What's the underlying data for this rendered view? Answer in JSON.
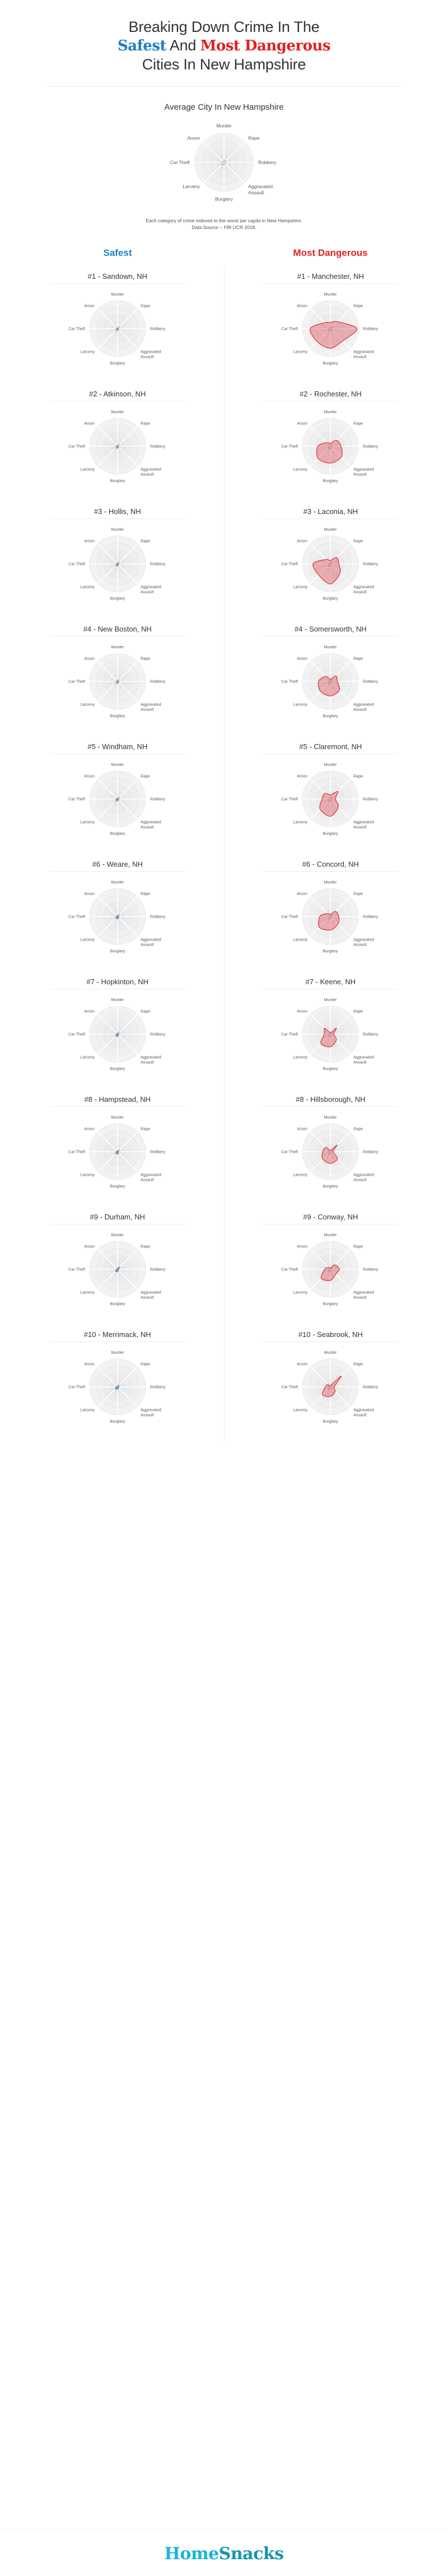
{
  "title": {
    "line1": "Breaking Down Crime In The",
    "line2_a": "Safest",
    "line2_b": "And",
    "line2_c": "Most Dangerous",
    "line3": "Cities In New Hampshire"
  },
  "reference": {
    "heading": "Average City In New Hampshire",
    "source_line1": "Each category of crime indexed to the worst per capita in New Hampshire.",
    "source_line2": "Data Source -- FBI UCR 2018."
  },
  "axes": [
    "Murder",
    "Rape",
    "Robbery",
    "Aggravated Assault",
    "Burglary",
    "Larceny",
    "Car Theft",
    "Arson"
  ],
  "columns": {
    "safest_label": "Safest",
    "dangerous_label": "Most Dangerous"
  },
  "colors": {
    "safe": "#2e86c8",
    "safe_fill": "rgba(46,134,200,0.45)",
    "danger": "#d6323c",
    "danger_fill": "rgba(214,50,60,0.35)",
    "average_fill": "rgba(150,150,150,0.30)",
    "grid": "#ededed",
    "title_blue": "#1d7fc4",
    "title_red": "#e02020",
    "logo_light": "#18b6d8",
    "logo_dark": "#1596ad"
  },
  "footer": {
    "logo_part1": "Home",
    "logo_part2": "Snacks"
  },
  "chart_data": {
    "type": "radar",
    "title": "Breaking Down Crime In The Safest And Most Dangerous Cities In New Hampshire",
    "subtitle": "Each category of crime indexed to the worst per capita in New Hampshire. Data Source -- FBI UCR 2018.",
    "categories": [
      "Murder",
      "Rape",
      "Robbery",
      "Aggravated Assault",
      "Burglary",
      "Larceny",
      "Car Theft",
      "Arson"
    ],
    "rlim": [
      0,
      1
    ],
    "grid": true,
    "legend": "none",
    "reference_series": {
      "name": "Average City In New Hampshire",
      "values": [
        0.06,
        0.1,
        0.05,
        0.07,
        0.09,
        0.12,
        0.07,
        0.05
      ]
    },
    "safest": [
      {
        "rank": "#1",
        "city": "Sandown, NH",
        "label": "#1 - Sandown, NH",
        "values": [
          0.0,
          0.02,
          0.0,
          0.02,
          0.05,
          0.04,
          0.01,
          0.0
        ]
      },
      {
        "rank": "#2",
        "city": "Atkinson, NH",
        "label": "#2 - Atkinson, NH",
        "values": [
          0.0,
          0.02,
          0.0,
          0.02,
          0.05,
          0.05,
          0.02,
          0.0
        ]
      },
      {
        "rank": "#3",
        "city": "Hollis, NH",
        "label": "#3 - Hollis, NH",
        "values": [
          0.0,
          0.03,
          0.0,
          0.01,
          0.06,
          0.05,
          0.02,
          0.0
        ]
      },
      {
        "rank": "#4",
        "city": "New Boston, NH",
        "label": "#4 - New Boston, NH",
        "values": [
          0.0,
          0.03,
          0.0,
          0.03,
          0.05,
          0.04,
          0.02,
          0.01
        ]
      },
      {
        "rank": "#5",
        "city": "Windham, NH",
        "label": "#5 - Windham, NH",
        "values": [
          0.0,
          0.04,
          0.01,
          0.03,
          0.05,
          0.06,
          0.03,
          0.0
        ]
      },
      {
        "rank": "#6",
        "city": "Weare, NH",
        "label": "#6 - Weare, NH",
        "values": [
          0.0,
          0.05,
          0.0,
          0.05,
          0.07,
          0.06,
          0.03,
          0.02
        ]
      },
      {
        "rank": "#7",
        "city": "Hopkinton, NH",
        "label": "#7 - Hopkinton, NH",
        "values": [
          0.0,
          0.04,
          0.0,
          0.04,
          0.07,
          0.07,
          0.03,
          0.01
        ]
      },
      {
        "rank": "#8",
        "city": "Hampstead, NH",
        "label": "#8 - Hampstead, NH",
        "values": [
          0.0,
          0.05,
          0.0,
          0.04,
          0.08,
          0.07,
          0.03,
          0.01
        ]
      },
      {
        "rank": "#9",
        "city": "Durham, NH",
        "label": "#9 - Durham, NH",
        "values": [
          0.0,
          0.12,
          0.0,
          0.04,
          0.08,
          0.09,
          0.02,
          0.01
        ]
      },
      {
        "rank": "#10",
        "city": "Merrimack, NH",
        "label": "#10 - Merrimack, NH",
        "values": [
          0.0,
          0.06,
          0.01,
          0.05,
          0.08,
          0.1,
          0.04,
          0.01
        ]
      }
    ],
    "most_dangerous": [
      {
        "rank": "#1",
        "city": "Manchester, NH",
        "label": "#1 - Manchester, NH",
        "values": [
          0.22,
          0.35,
          0.95,
          0.62,
          0.7,
          0.66,
          0.72,
          0.3
        ]
      },
      {
        "rank": "#2",
        "city": "Rochester, NH",
        "label": "#2 - Rochester, NH",
        "values": [
          0.1,
          0.3,
          0.38,
          0.55,
          0.6,
          0.62,
          0.45,
          0.18
        ]
      },
      {
        "rank": "#3",
        "city": "Laconia, NH",
        "label": "#3 - Laconia, NH",
        "values": [
          0.12,
          0.32,
          0.3,
          0.48,
          0.72,
          0.58,
          0.62,
          0.22
        ]
      },
      {
        "rank": "#4",
        "city": "Somersworth, NH",
        "label": "#4 - Somersworth, NH",
        "values": [
          0.08,
          0.28,
          0.25,
          0.45,
          0.52,
          0.5,
          0.42,
          0.25
        ]
      },
      {
        "rank": "#5",
        "city": "Claremont, NH",
        "label": "#5 - Claremont, NH",
        "values": [
          0.15,
          0.38,
          0.18,
          0.4,
          0.62,
          0.52,
          0.3,
          0.28
        ]
      },
      {
        "rank": "#6",
        "city": "Concord, NH",
        "label": "#6 - Concord, NH",
        "values": [
          0.08,
          0.26,
          0.3,
          0.38,
          0.48,
          0.55,
          0.38,
          0.15
        ]
      },
      {
        "rank": "#7",
        "city": "Keene, NH",
        "label": "#7 - Keene, NH",
        "values": [
          0.06,
          0.3,
          0.12,
          0.3,
          0.45,
          0.48,
          0.22,
          0.3
        ]
      },
      {
        "rank": "#8",
        "city": "Hillsborough, NH",
        "label": "#8 - Hillsborough, NH",
        "values": [
          0.05,
          0.34,
          0.1,
          0.36,
          0.42,
          0.38,
          0.28,
          0.22
        ]
      },
      {
        "rank": "#9",
        "city": "Conway, NH",
        "label": "#9 - Conway, NH",
        "values": [
          0.04,
          0.22,
          0.32,
          0.26,
          0.4,
          0.46,
          0.2,
          0.1
        ]
      },
      {
        "rank": "#10",
        "city": "Seabrook, NH",
        "label": "#10 - Seabrook, NH",
        "values": [
          0.05,
          0.55,
          0.14,
          0.24,
          0.34,
          0.4,
          0.18,
          0.12
        ]
      }
    ]
  }
}
